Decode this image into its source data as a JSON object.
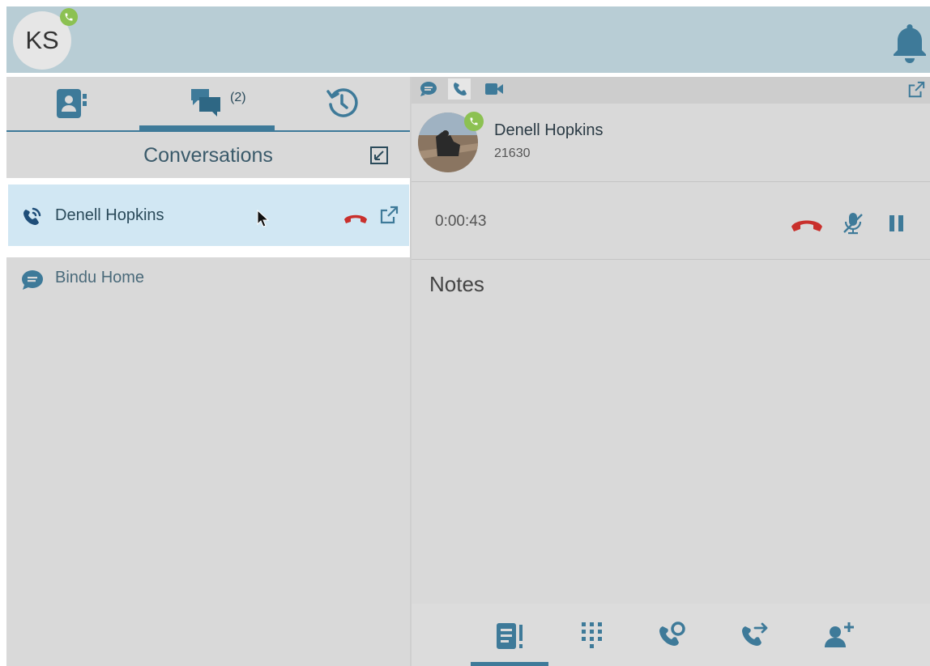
{
  "header": {
    "user_initials": "KS"
  },
  "left_tabs": {
    "conversations_count": "(2)"
  },
  "conversations": {
    "title": "Conversations",
    "items": [
      {
        "name": "Denell Hopkins",
        "type": "call",
        "active": true
      },
      {
        "name": "Bindu Home",
        "type": "chat",
        "active": false
      }
    ]
  },
  "call": {
    "contact_name": "Denell Hopkins",
    "contact_number": "21630",
    "duration": "0:00:43",
    "notes_label": "Notes"
  },
  "colors": {
    "accent": "#3e7a99",
    "header_bg": "#b8cdd5",
    "status_green": "#8cc152",
    "hangup_red": "#c9302c",
    "active_row_bg": "#d1e7f3"
  }
}
